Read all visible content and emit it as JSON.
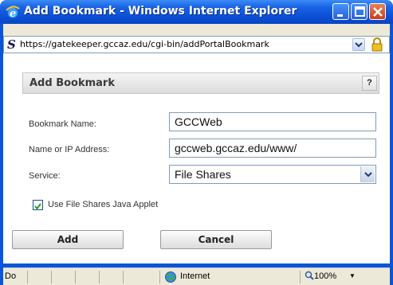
{
  "window": {
    "title": "Add Bookmark - Windows Internet Explorer"
  },
  "address_bar": {
    "url": "https://gatekeeper.gccaz.edu/cgi-bin/addPortalBookmark",
    "site_icon": "s-icon",
    "security": "lock-icon"
  },
  "panel": {
    "title": "Add Bookmark",
    "help_label": "?"
  },
  "form": {
    "bookmark_name_label": "Bookmark Name:",
    "bookmark_name_value": "GCCWeb",
    "address_label": "Name or IP Address:",
    "address_value": "gccweb.gccaz.edu/www/",
    "service_label": "Service:",
    "service_value": "File Shares",
    "applet_checkbox_label": "Use File Shares Java Applet",
    "applet_checked": true
  },
  "buttons": {
    "add_label": "Add",
    "cancel_label": "Cancel"
  },
  "status_bar": {
    "text": "Do",
    "zone": "Internet",
    "zoom": "100%"
  },
  "colors": {
    "titlebar": "#0b4fd6",
    "chrome": "#ece9d8",
    "checkbox_check": "#21a121"
  }
}
